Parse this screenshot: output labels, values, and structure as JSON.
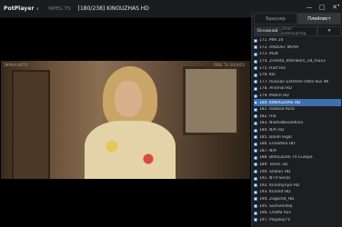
{
  "app": {
    "brand": "PotPlayer",
    "brand_caret": "∨",
    "format": "MPEG TS",
    "title": "[180/238] KINOUZHAS HD"
  },
  "window_controls": [
    "—",
    "□",
    "✕"
  ],
  "video": {
    "watermark_left": "ЭКРАН HDTV",
    "watermark_right": "FREE TV SOURCE"
  },
  "panel": {
    "pin": "•",
    "tabs": [
      {
        "label": "Браузер",
        "active": false
      },
      {
        "label": "Плейлист",
        "active": true
      }
    ],
    "subtabs": [
      {
        "label": "Основной",
        "active": true
      },
      {
        "label": "Этот компьютер",
        "active": false
      },
      {
        "label": "▼",
        "active": false
      }
    ],
    "items": [
      "171. MIR 24",
      "172. RADOST MOYA",
      "173. Mult",
      "174. Zvezda_Interworx_18_mux3",
      "175. Hart HD",
      "176. Kik",
      "177. Russian Extreme Ultra Rus 4K",
      "178. Arsenal HD",
      "179. Match HD",
      "180. KINOUZHAS HD",
      "181. Rodnoe Kino",
      "182. HIS",
      "183. NashaNovosKino",
      "184. N/A HD",
      "185. Bandi legal",
      "186. Eroxotika HD",
      "187. N/A",
      "188. BRAZZERS TV Europe",
      "189. Teens 3D",
      "190. Shalun HD",
      "191. NTV-Serial",
      "192. Kinomyriya HD",
      "193. Kinohit HD",
      "194. Zagorod_HD",
      "195. Sochelnitsa",
      "196. CIGMa Rus",
      "197. PlayboyTV"
    ],
    "selected_index": 9
  }
}
